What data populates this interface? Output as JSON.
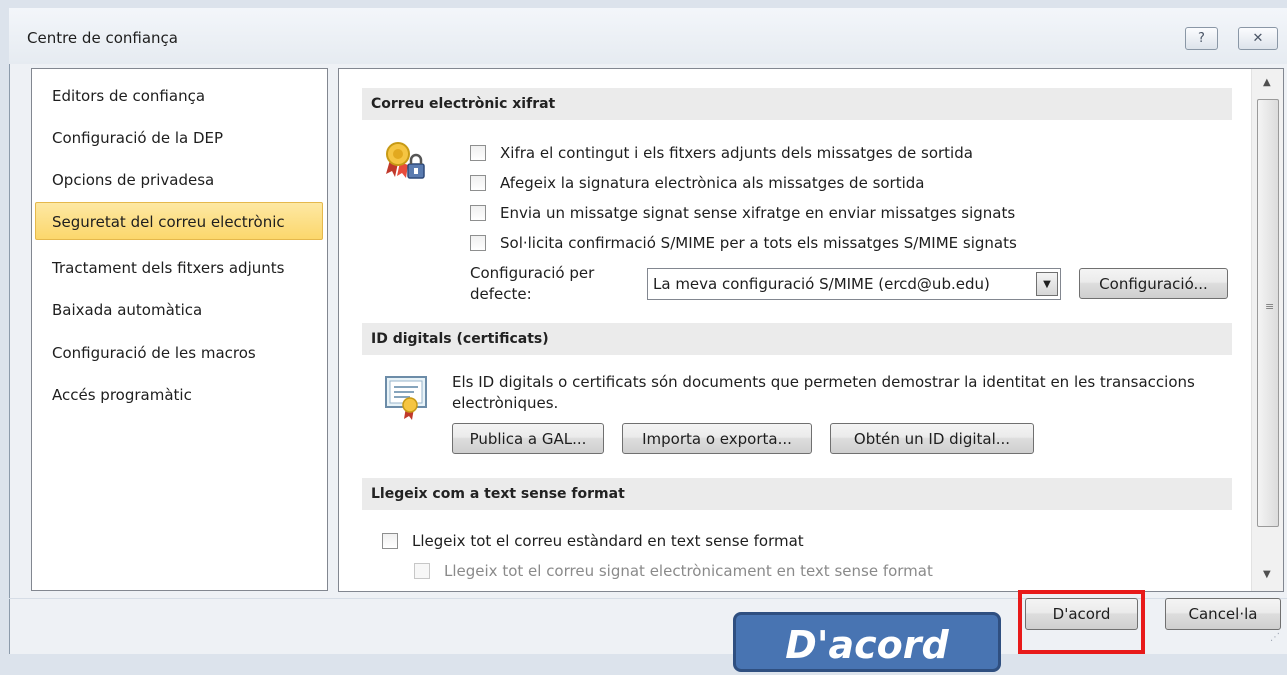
{
  "window": {
    "title": "Centre de confiança",
    "help_glyph": "?",
    "close_glyph": "✕"
  },
  "sidebar": {
    "items": [
      {
        "label": "Editors de confiança"
      },
      {
        "label": "Configuració de la DEP"
      },
      {
        "label": "Opcions de privadesa"
      },
      {
        "label": "Seguretat del correu electrònic",
        "active": true
      },
      {
        "label": "Tractament dels fitxers adjunts"
      },
      {
        "label": "Baixada automàtica"
      },
      {
        "label": "Configuració de les macros"
      },
      {
        "label": "Accés programàtic"
      }
    ]
  },
  "encrypted": {
    "header": "Correu electrònic xifrat",
    "options": [
      {
        "label": "Xifra el contingut i els fitxers adjunts dels missatges de sortida",
        "checked": false
      },
      {
        "label": "Afegeix la signatura electrònica als missatges de sortida",
        "checked": false
      },
      {
        "label": "Envia un missatge signat sense xifratge en enviar missatges signats",
        "checked": false
      },
      {
        "label": "Sol·licita confirmació S/MIME per a tots els missatges S/MIME signats",
        "checked": false
      }
    ],
    "default_label_1": "Configuració per",
    "default_label_2": "defecte:",
    "default_value": "La meva configuració S/MIME (ercd@ub.edu)",
    "settings_button": "Configuració..."
  },
  "digital_ids": {
    "header": "ID digitals (certificats)",
    "description": "Els ID digitals o certificats són documents que permeten demostrar la identitat en les transaccions electròniques.",
    "buttons": {
      "publish": "Publica a GAL...",
      "import": "Importa o exporta...",
      "get": "Obtén un ID digital..."
    }
  },
  "plain_text": {
    "header": "Llegeix com a text sense format",
    "read_all": {
      "label": "Llegeix tot el correu estàndard en text sense format",
      "checked": false
    },
    "read_signed": {
      "label": "Llegeix tot el correu signat electrònicament en text sense format",
      "checked": false,
      "enabled": false
    }
  },
  "footer": {
    "ok": "D'acord",
    "cancel": "Cancel·la"
  },
  "annotation": {
    "callout": "D'acord",
    "highlight_color": "#e81a1a",
    "callout_color": "#4874b2"
  },
  "colors": {
    "active_item": "#fcd76c",
    "section_header": "#ebebeb"
  }
}
